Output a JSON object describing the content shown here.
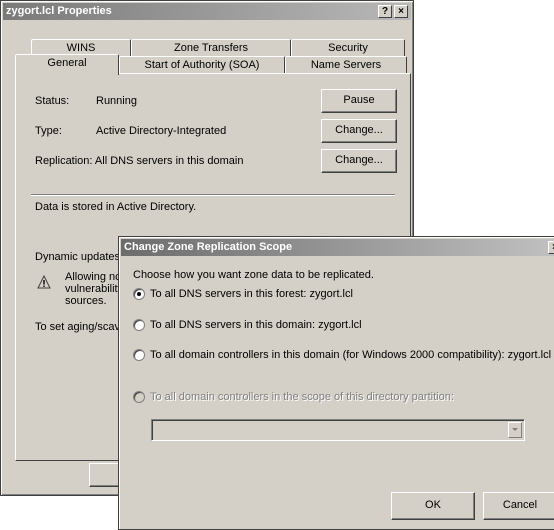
{
  "properties": {
    "title": "zygort.lcl Properties",
    "help_glyph": "?",
    "close_glyph": "×",
    "tabs_back": [
      "WINS",
      "Zone Transfers",
      "Security"
    ],
    "tabs_front": [
      "General",
      "Start of Authority (SOA)",
      "Name Servers"
    ],
    "status_label": "Status:",
    "status_value": "Running",
    "pause_button": "Pause",
    "type_label": "Type:",
    "type_value": "Active Directory-Integrated",
    "change_type_button": "Change...",
    "replication_text": "Replication:  All DNS servers in this domain",
    "change_replication_button": "Change...",
    "storage_text": "Data is stored in Active Directory.",
    "dynamic_updates_text": "Dynamic updates",
    "warning_lines": [
      "Allowing nc",
      "vulnerability",
      "sources."
    ],
    "aging_text": "To set aging/scav"
  },
  "scope_dialog": {
    "title": "Change Zone Replication Scope",
    "close_glyph": "×",
    "prompt": "Choose how you want zone data to be replicated.",
    "options": [
      {
        "label": "To all DNS servers in this forest:  zygort.lcl",
        "selected": true,
        "enabled": true
      },
      {
        "label": "To all DNS servers in this domain:  zygort.lcl",
        "selected": false,
        "enabled": true
      },
      {
        "label": "To all domain controllers in this domain (for Windows 2000 compatibility):  zygort.lcl",
        "selected": false,
        "enabled": true
      },
      {
        "label": "To all domain controllers in the scope of this directory partition:",
        "selected": false,
        "enabled": false
      }
    ],
    "partition_value": "",
    "ok_button": "OK",
    "cancel_button": "Cancel"
  }
}
